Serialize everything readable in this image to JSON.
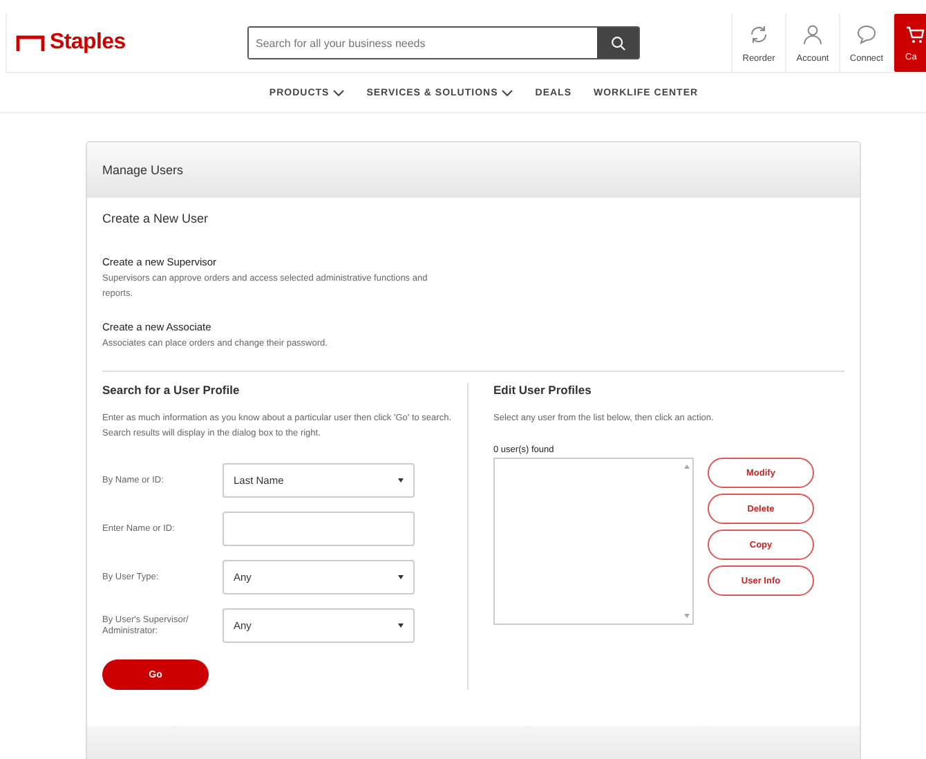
{
  "header": {
    "logo": "Staples",
    "search": {
      "placeholder": "Search for all your business needs"
    },
    "actions": [
      {
        "kind": "reorder",
        "label": "Reorder"
      },
      {
        "kind": "account",
        "label": "Account"
      },
      {
        "kind": "connect",
        "label": "Connect"
      },
      {
        "kind": "cart",
        "label": "Ca"
      }
    ]
  },
  "nav": [
    {
      "label": "PRODUCTS",
      "dropdown": true
    },
    {
      "label": "SERVICES & SOLUTIONS",
      "dropdown": true
    },
    {
      "label": "DEALS",
      "dropdown": false
    },
    {
      "label": "WORKLIFE CENTER",
      "dropdown": false
    }
  ],
  "panel": {
    "title": "Manage Users",
    "create": {
      "heading": "Create a New User",
      "options": [
        {
          "title": "Create a new Supervisor",
          "description": "Supervisors can approve orders and access selected administrative functions and reports."
        },
        {
          "title": "Create a new Associate",
          "description": "Associates can place orders and change their password."
        }
      ]
    },
    "search": {
      "heading": "Search for a User Profile",
      "description": "Enter as much information as you know about a particular user then click 'Go' to search. Search results will display in the dialog box to the right.",
      "fields": [
        {
          "kind": "select",
          "label": "By Name or ID:",
          "value": "Last Name"
        },
        {
          "kind": "text",
          "label": "Enter Name or ID:"
        },
        {
          "kind": "select",
          "label": "By User Type:",
          "value": "Any"
        },
        {
          "kind": "select",
          "label": "By User's Supervisor/ Administrator:",
          "value": "Any"
        }
      ],
      "button": "Go"
    },
    "edit": {
      "heading": "Edit User Profiles",
      "description": "Select any user from the list below, then click an action.",
      "count": "0 user(s) found",
      "actions": [
        "Modify",
        "Delete",
        "Copy",
        "User Info"
      ]
    }
  }
}
